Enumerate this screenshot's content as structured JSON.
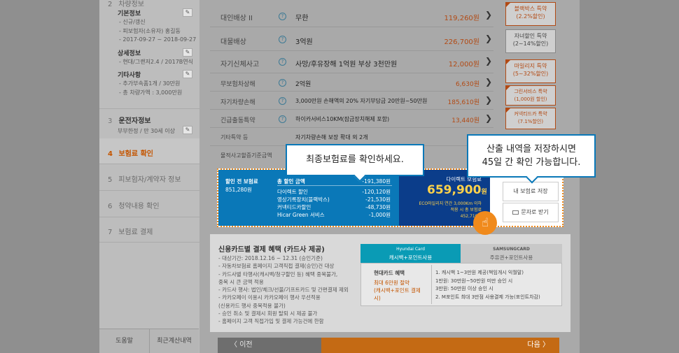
{
  "sidebar": {
    "step2": {
      "num": "2",
      "label": "차량정보"
    },
    "basic": {
      "title": "기본정보",
      "lines": [
        "- 신규/갱신",
        "- 피보험자(소유자) 홍길동",
        "- 2017-09-27 ~ 2018-09-27"
      ]
    },
    "detail": {
      "title": "상세정보",
      "lines": [
        "- 현대/그랜저2.4 / 2017B연식"
      ]
    },
    "etc": {
      "title": "기타사항",
      "lines": [
        "- 추가부속품1개 / 30만원",
        "- 총 차량가액 : 3,000만원"
      ]
    },
    "step3": {
      "num": "3",
      "label": "운전자정보",
      "line": "부부한정 / 만 30세 이상"
    },
    "step4": {
      "num": "4",
      "label": "보험료 확인"
    },
    "step5": {
      "num": "5",
      "label": "피보험자/계약자 정보"
    },
    "step6": {
      "num": "6",
      "label": "청약내용 확인"
    },
    "step7": {
      "num": "7",
      "label": "보험료 결제"
    },
    "help": "도움말",
    "recent": "최근계산내역",
    "edit_icon": "pencil-icon"
  },
  "coverage": [
    {
      "name": "대인배상 II",
      "value": "무한",
      "price": "119,260원"
    },
    {
      "name": "대물배상",
      "value": "3억원",
      "price": "226,700원"
    },
    {
      "name": "자기신체사고",
      "value": "사망/후유장해 1억원 부상 3천만원",
      "price": "12,000원"
    },
    {
      "name": "무보험차상해",
      "value": "2억원",
      "price": "6,630원"
    },
    {
      "name": "자기차량손해",
      "value": "3,000만원 손해액의 20% 자기부담금 20만원~50만원",
      "price": "185,610원"
    },
    {
      "name": "긴급출동특약",
      "value": "하이카서비스10KM(잠금장치해제 포함)",
      "price": "13,440원"
    },
    {
      "name": "기타특약 등",
      "value": "자기차량손해 보장 확대 외 2개",
      "price": ""
    },
    {
      "name": "물적사고할증기준금액",
      "value": "",
      "price": ""
    }
  ],
  "special_terms": [
    {
      "label": "블랙박스 특약",
      "sub": "(2.2%할인)"
    },
    {
      "label": "자녀할인 특약",
      "sub": "(2~14%할인)"
    },
    {
      "label": "마일리지 특약",
      "sub": "(5~32%할인)"
    },
    {
      "label": "그린서비스 특약",
      "sub": "(1,000원 할인)"
    },
    {
      "label": "커넥티드카 특약",
      "sub": "(7.1%할인)"
    }
  ],
  "summary": {
    "before_label": "할인 전 보험료",
    "before_value": "851,280원",
    "total_discount_label": "총 할인 금액",
    "total_discount_value": "-191,380원",
    "discounts": [
      {
        "label": "다이렉트 할인",
        "value": "-120,120원"
      },
      {
        "label": "영상기록장치(블랙박스)",
        "value": "-21,530원"
      },
      {
        "label": "커넥티드카할인",
        "value": "-48,730원"
      },
      {
        "label": "Hicar Green 서비스",
        "value": "-1,000원"
      }
    ],
    "direct_label": "다이렉트 보험료",
    "direct_value": "659,900",
    "direct_unit": "원",
    "eco_line1": "ECO마일리지 연간 3,000Km 이하",
    "eco_line2": "적용 시 총 보험료",
    "eco_value": "452,710원"
  },
  "buttons": {
    "save": "내 보험료 저장",
    "sms": "문자로 받기"
  },
  "tooltips": {
    "final": "최종보험료를 확인하세요.",
    "save_line1": "산출 내역을 저장하시면",
    "save_line2": "45일 간 확인 가능합니다."
  },
  "card": {
    "title": "신용카드별 결제 혜택 (카드사 제공)",
    "bullets": [
      "- 대상기간: 2018.12.16 ~ 12.31 (승인기준)",
      "- 자동차보험료 홈페이지 고객직접 결제(승인)건 대상",
      "- 카드사별 타행사(캐시백/청구할인 등) 혜택 중복불가,",
      "  중복 시 큰 금액 적용",
      "- 카드사 행사: 법인/체크/선불/기프트카드 및 간편결제 제외",
      "- 카카오페이 이용시 카카오페이 행사 우선적용",
      "  (신용카드 행사 중복적용 불가)",
      "- 승인 취소 및 결제시 회원 탈퇴 시 제공 불가",
      "- 홈페이지 고객 직접가입 및 결제 가능건에 한함"
    ],
    "hyundai_brand": "Hyundai Card",
    "hyundai_tab": "캐시백+포인트사용",
    "samsung_brand": "SAMSUNGCARD",
    "samsung_tab": "주유권+포인트사용",
    "benefit_title": "현대카드 혜택",
    "benefit_desc": [
      "최대 6만원 절약",
      "(캐시백+포인트 결제",
      "시)"
    ],
    "benefit_list": [
      "1. 캐시백 1~3만원 제공(책임개시 익월말)",
      "1만원: 30만원~50만원 미만 승인 시",
      "3만원: 50만원 이상 승인 시",
      "2. M포인트 최대 3만점 사용결제 가능(포인트차감)"
    ]
  },
  "nav": {
    "prev": "이전",
    "next": "다음"
  }
}
